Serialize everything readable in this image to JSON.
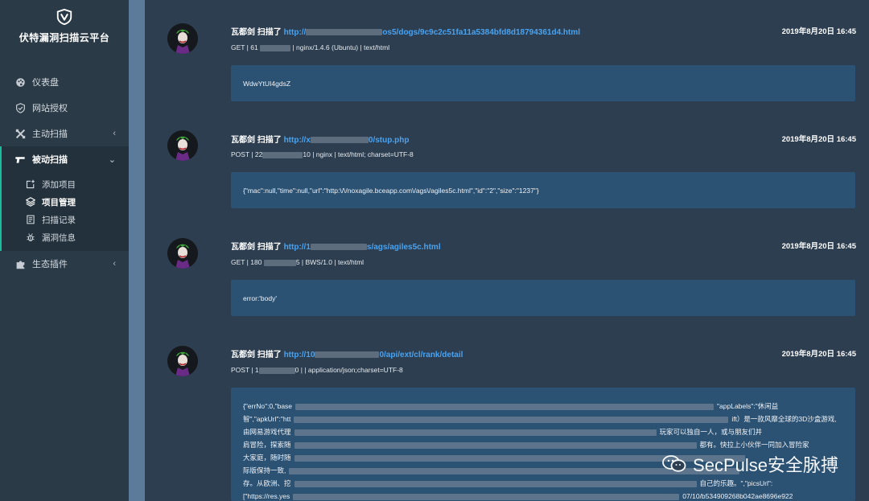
{
  "brand": {
    "title": "伏特漏洞扫描云平台",
    "logo_icon": "shield-v-logo-icon"
  },
  "nav": {
    "dashboard": "仪表盘",
    "site_auth": "网站授权",
    "active_scan": "主动扫描",
    "passive_scan": "被动扫描",
    "plugins": "生态插件"
  },
  "subnav": {
    "add_project": "添加项目",
    "project_manage": "项目管理",
    "scan_records": "扫描记录",
    "vuln_info": "漏洞信息"
  },
  "entries": [
    {
      "user": "瓦都剑",
      "action": "扫描了",
      "url_start": "http://",
      "url_end": "os5/dogs/9c9c2c51fa11a5384bfd8d18794361d4.html",
      "time": "2019年8月20日 16:45",
      "meta_start": "GET | 61",
      "meta_end": "| nginx/1.4.6 (Ubuntu) | text/html",
      "body": "WdwYtUI4gdsZ"
    },
    {
      "user": "瓦都剑",
      "action": "扫描了",
      "url_start": "http://x",
      "url_end": "0/stup.php",
      "time": "2019年8月20日 16:45",
      "meta_start": "POST | 22",
      "meta_end": "10 | nginx | text/html; charset=UTF-8",
      "body": "{\"mac\":null,\"time\":null,\"url\":\"http:\\/\\/noxagile.bceapp.com\\/ags\\/agiles5c.html\",\"id\":\"2\",\"size\":\"1237\"}"
    },
    {
      "user": "瓦都剑",
      "action": "扫描了",
      "url_start": "http://1",
      "url_end": "s/ags/agiles5c.html",
      "time": "2019年8月20日 16:45",
      "meta_start": "GET | 180",
      "meta_end": "5 | BWS/1.0 | text/html",
      "body": "error:'body'"
    },
    {
      "user": "瓦都剑",
      "action": "扫描了",
      "url_start": "http://10",
      "url_end": "0/api/ext/cl/rank/detail",
      "time": "2019年8月20日 16:45",
      "meta_start": "POST | 1",
      "meta_end": "0 |  | application/json;charset=UTF-8",
      "body_lines": [
        "{\"errNo\":0,\"base",
        "\"appLabels\":\"休闲益",
        "智\",\"apkUrl\":\"htt",
        "ift）是一款风靡全球的3D沙盒游戏,",
        "由网易游戏代理",
        "玩家可以独自一人，或与朋友们并",
        "肩冒险，探索随",
        "都有。快拉上小伙伴一同加入冒险家",
        "大家庭，随时随",
        "际版保持一致,",
        "存。从欧洲、挖",
        "自己的乐趣。\",\"picsUrl\":",
        "[\"https://res.yes",
        "07/10/b534909268b042ae8696e922"
      ]
    }
  ],
  "watermark": {
    "text": "SecPulse安全脉搏",
    "icon": "wechat-icon"
  },
  "colors": {
    "sidebar": "#2b3a47",
    "content": "#2d3e50",
    "box": "#2b5173",
    "link": "#4aa3f0",
    "active_bar": "#1abc9c"
  }
}
